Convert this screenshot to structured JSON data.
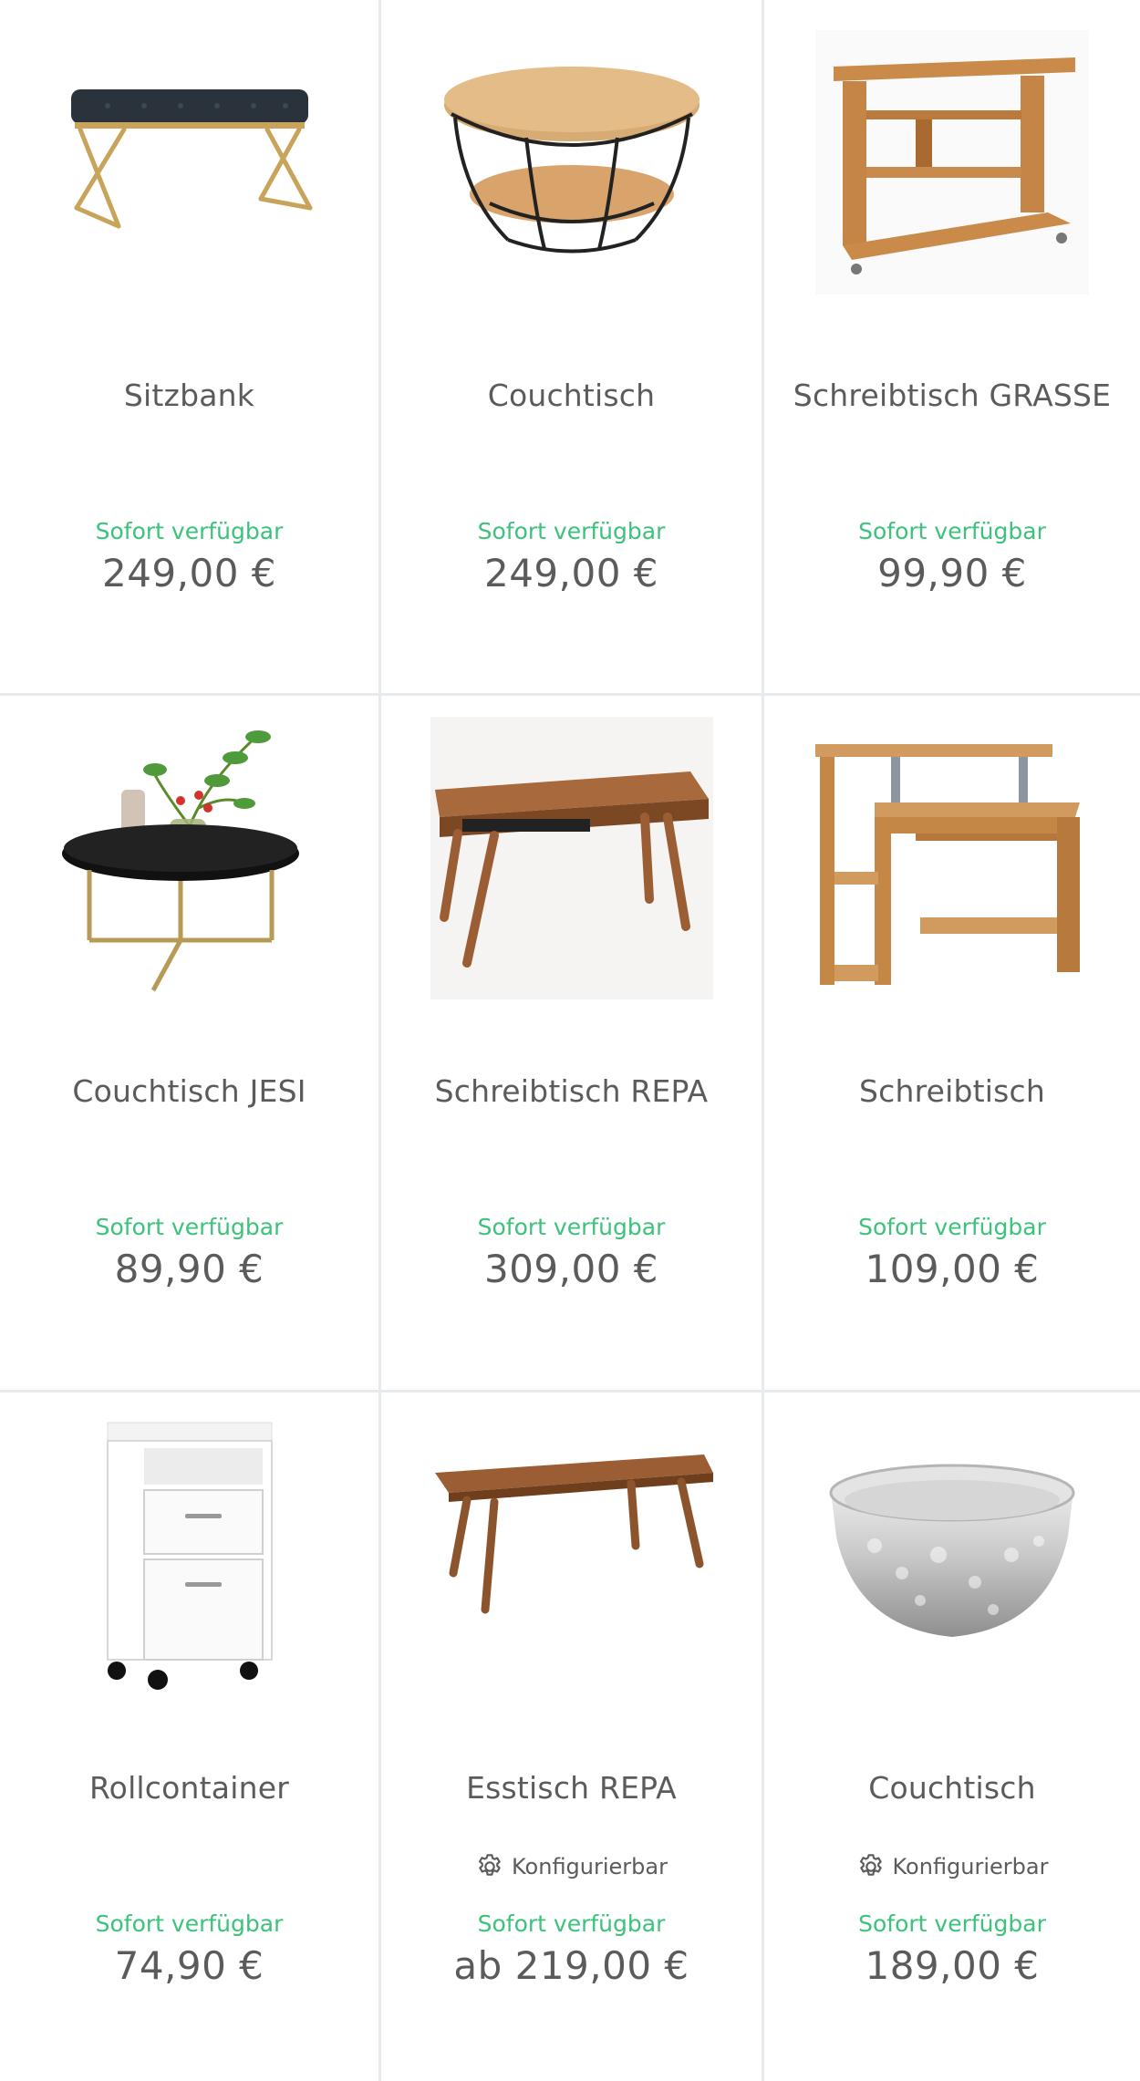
{
  "products": [
    {
      "name": "Sitzbank",
      "availability": "Sofort verfügbar",
      "price": "249,00 €",
      "image_icon": "bench-icon"
    },
    {
      "name": "Couchtisch",
      "availability": "Sofort verfügbar",
      "price": "249,00 €",
      "image_icon": "round-coffee-table-icon"
    },
    {
      "name": "Schreibtisch GRASSE",
      "availability": "Sofort verfügbar",
      "price": "99,90 €",
      "image_icon": "desk-icon"
    },
    {
      "name": "Couchtisch JESI",
      "availability": "Sofort verfügbar",
      "price": "89,90 €",
      "image_icon": "tray-table-icon"
    },
    {
      "name": "Schreibtisch REPA",
      "availability": "Sofort verfügbar",
      "price": "309,00 €",
      "image_icon": "wood-desk-icon"
    },
    {
      "name": "Schreibtisch",
      "availability": "Sofort verfügbar",
      "price": "109,00 €",
      "image_icon": "computer-desk-icon"
    },
    {
      "name": "Rollcontainer",
      "availability": "Sofort verfügbar",
      "price": "74,90 €",
      "image_icon": "drawer-cabinet-icon"
    },
    {
      "name": "Esstisch REPA",
      "configurable": "Konfigurierbar",
      "availability": "Sofort verfügbar",
      "price": "ab 219,00 €",
      "image_icon": "dining-table-icon"
    },
    {
      "name": "Couchtisch",
      "configurable": "Konfigurierbar",
      "availability": "Sofort verfügbar",
      "price": "189,00 €",
      "image_icon": "hammered-bowl-table-icon"
    }
  ],
  "colors": {
    "availability": "#3cc27b",
    "text": "#5b5b5b",
    "divider": "#e8ebee"
  }
}
